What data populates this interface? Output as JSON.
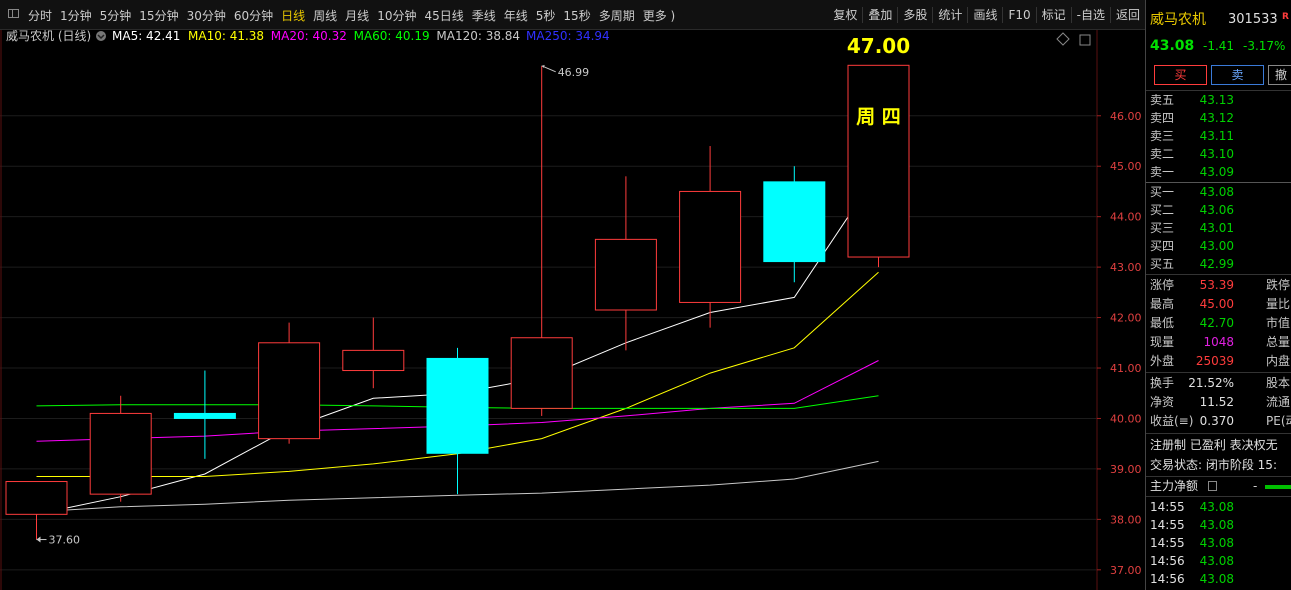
{
  "toolbar": {
    "periods": [
      "分时",
      "1分钟",
      "5分钟",
      "15分钟",
      "30分钟",
      "60分钟",
      "日线",
      "周线",
      "月线",
      "10分钟",
      "45日线",
      "季线",
      "年线",
      "5秒",
      "15秒",
      "多周期",
      "更多 )"
    ],
    "active_period": "日线",
    "tools": [
      "复权",
      "叠加",
      "多股",
      "统计",
      "画线",
      "F10",
      "标记",
      "-自选",
      "返回"
    ]
  },
  "legend": {
    "title": "威马农机 (日线)",
    "ma": [
      {
        "label": "MA5: 42.41",
        "color": "#ffffff"
      },
      {
        "label": "MA10: 41.38",
        "color": "#ffff00"
      },
      {
        "label": "MA20: 40.32",
        "color": "#ff00ff"
      },
      {
        "label": "MA60: 40.19",
        "color": "#00ff00"
      },
      {
        "label": "MA120: 38.84",
        "color": "#c8c8c8"
      },
      {
        "label": "MA250: 34.94",
        "color": "#3030ff"
      }
    ]
  },
  "callouts": {
    "high": "46.99",
    "low": "37.60",
    "current_price": "47.00",
    "weekday": "周 四"
  },
  "chart_data": {
    "type": "candlestick",
    "ylim": [
      36.6,
      47.7
    ],
    "y_ticks": [
      37.0,
      38.0,
      39.0,
      40.0,
      41.0,
      42.0,
      43.0,
      44.0,
      45.0,
      46.0
    ],
    "y_tick_labels": [
      "37.00",
      "38.00",
      "39.00",
      "40.00",
      "41.00",
      "42.00",
      "43.00",
      "44.00",
      "45.00",
      "46.00"
    ],
    "candles": [
      {
        "o": 38.1,
        "c": 38.75,
        "h": 38.75,
        "l": 37.6
      },
      {
        "o": 38.5,
        "c": 40.1,
        "h": 40.45,
        "l": 38.35
      },
      {
        "o": 40.05,
        "c": 40.05,
        "h": 40.95,
        "l": 39.2
      },
      {
        "o": 39.6,
        "c": 41.5,
        "h": 41.9,
        "l": 39.5
      },
      {
        "o": 40.95,
        "c": 41.35,
        "h": 42.0,
        "l": 40.6
      },
      {
        "o": 41.2,
        "c": 39.3,
        "h": 41.4,
        "l": 38.5
      },
      {
        "o": 40.2,
        "c": 41.6,
        "h": 46.99,
        "l": 40.05
      },
      {
        "o": 42.15,
        "c": 43.55,
        "h": 44.8,
        "l": 41.35
      },
      {
        "o": 42.3,
        "c": 44.5,
        "h": 45.4,
        "l": 41.8
      },
      {
        "o": 44.7,
        "c": 43.1,
        "h": 45.0,
        "l": 42.7
      },
      {
        "o": 43.2,
        "c": 47.0,
        "h": 47.0,
        "l": 43.0
      }
    ],
    "series": [
      {
        "name": "MA5",
        "color": "#ffffff",
        "values": [
          38.1,
          38.45,
          38.9,
          39.8,
          40.4,
          40.5,
          40.8,
          41.5,
          42.1,
          42.4,
          44.9
        ]
      },
      {
        "name": "MA10",
        "color": "#ffff00",
        "values": [
          38.85,
          38.85,
          38.85,
          38.95,
          39.1,
          39.3,
          39.6,
          40.2,
          40.9,
          41.4,
          42.9
        ]
      },
      {
        "name": "MA20",
        "color": "#ff00ff",
        "values": [
          39.55,
          39.6,
          39.65,
          39.75,
          39.8,
          39.85,
          39.92,
          40.05,
          40.2,
          40.3,
          41.15
        ]
      },
      {
        "name": "MA60",
        "color": "#00ff00",
        "values": [
          40.25,
          40.27,
          40.27,
          40.27,
          40.25,
          40.22,
          40.2,
          40.2,
          40.2,
          40.2,
          40.45
        ]
      },
      {
        "name": "MA120",
        "color": "#c8c8c8",
        "values": [
          38.15,
          38.25,
          38.3,
          38.38,
          38.43,
          38.48,
          38.52,
          38.6,
          38.68,
          38.8,
          39.15
        ]
      }
    ]
  },
  "side": {
    "name": "威马农机",
    "code": "301533",
    "r_badge": "R",
    "price": "43.08",
    "change": "-1.41",
    "pct": "-3.17%",
    "buy_btn": "买",
    "sell_btn": "卖",
    "third_btn": "撤",
    "asks": [
      {
        "label": "卖五",
        "price": "43.13"
      },
      {
        "label": "卖四",
        "price": "43.12"
      },
      {
        "label": "卖三",
        "price": "43.11"
      },
      {
        "label": "卖二",
        "price": "43.10"
      },
      {
        "label": "卖一",
        "price": "43.09"
      }
    ],
    "bids": [
      {
        "label": "买一",
        "price": "43.08"
      },
      {
        "label": "买二",
        "price": "43.06"
      },
      {
        "label": "买三",
        "price": "43.01"
      },
      {
        "label": "买四",
        "price": "43.00"
      },
      {
        "label": "买五",
        "price": "42.99"
      }
    ],
    "stats": [
      {
        "label": "涨停",
        "value": "53.39",
        "color": "red",
        "label2": "跌停"
      },
      {
        "label": "最高",
        "value": "45.00",
        "color": "red",
        "label2": "量比"
      },
      {
        "label": "最低",
        "value": "42.70",
        "color": "green",
        "label2": "市值"
      },
      {
        "label": "现量",
        "value": "1048",
        "color": "mag",
        "label2": "总量"
      },
      {
        "label": "外盘",
        "value": "25039",
        "color": "red",
        "label2": "内盘"
      }
    ],
    "stats2": [
      {
        "label": "换手",
        "value": "21.52%",
        "label2": "股本"
      },
      {
        "label": "净资",
        "value": "11.52",
        "label2": "流通"
      },
      {
        "label": "收益(≡)",
        "value": "0.370",
        "label2": "PE(动"
      }
    ],
    "info1": "注册制 已盈利 表决权无",
    "info2": "交易状态: 闭市阶段 15:",
    "main_flow": "主力净额",
    "main_flow_dash": "-",
    "ticks": [
      {
        "time": "14:55",
        "price": "43.08"
      },
      {
        "time": "14:55",
        "price": "43.08"
      },
      {
        "time": "14:55",
        "price": "43.08"
      },
      {
        "time": "14:56",
        "price": "43.08"
      },
      {
        "time": "14:56",
        "price": "43.08"
      }
    ]
  }
}
